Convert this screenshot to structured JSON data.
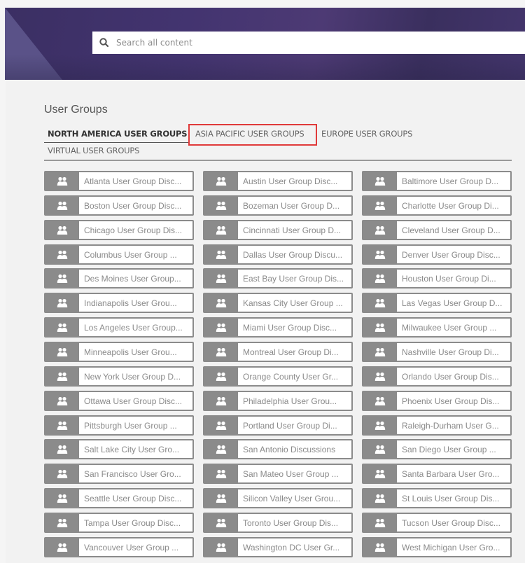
{
  "header": {
    "search": {
      "placeholder": "Search all content",
      "value": "",
      "icon": "search-icon"
    }
  },
  "section": {
    "title": "User Groups",
    "tabs": [
      {
        "label": "NORTH AMERICA USER GROUPS",
        "active": true
      },
      {
        "label": "ASIA PACIFIC USER GROUPS",
        "active": false,
        "highlighted": true
      },
      {
        "label": "EUROPE USER GROUPS",
        "active": false
      },
      {
        "label": "VIRTUAL USER GROUPS",
        "active": false
      }
    ]
  },
  "colors": {
    "banner": "#433470",
    "highlight_box": "#e03a3a",
    "card_icon_bg": "#8b8b8b"
  },
  "groups": {
    "icon": "users-icon",
    "columns": [
      [
        "Atlanta User Group Disc...",
        "Boston User Group Disc...",
        "Chicago User Group Dis...",
        "Columbus User Group ...",
        "Des Moines User Group...",
        "Indianapolis User Grou...",
        "Los Angeles User Group...",
        "Minneapolis User Grou...",
        "New York User Group D...",
        "Ottawa User Group Disc...",
        "Pittsburgh User Group ...",
        "Salt Lake City User Gro...",
        "San Francisco User Gro...",
        "Seattle User Group Disc...",
        "Tampa User Group Disc...",
        "Vancouver User Group ..."
      ],
      [
        "Austin User Group Disc...",
        "Bozeman User Group D...",
        "Cincinnati User Group D...",
        "Dallas User Group Discu...",
        "East Bay User Group Dis...",
        "Kansas City User Group ...",
        "Miami User Group Disc...",
        "Montreal User Group Di...",
        "Orange County User Gr...",
        "Philadelphia User Grou...",
        "Portland User Group Di...",
        "San Antonio Discussions",
        "San Mateo User Group ...",
        "Silicon Valley User Grou...",
        "Toronto User Group Dis...",
        "Washington DC User Gr..."
      ],
      [
        "Baltimore User Group D...",
        "Charlotte User Group Di...",
        "Cleveland User Group D...",
        "Denver User Group Disc...",
        "Houston User Group Di...",
        "Las Vegas User Group D...",
        "Milwaukee User Group ...",
        "Nashville User Group Di...",
        "Orlando User Group Dis...",
        "Phoenix User Group Dis...",
        "Raleigh-Durham User G...",
        "San Diego User Group ...",
        "Santa Barbara User Gro...",
        "St Louis User Group Dis...",
        "Tucson User Group Disc...",
        "West Michigan User Gro..."
      ]
    ]
  }
}
